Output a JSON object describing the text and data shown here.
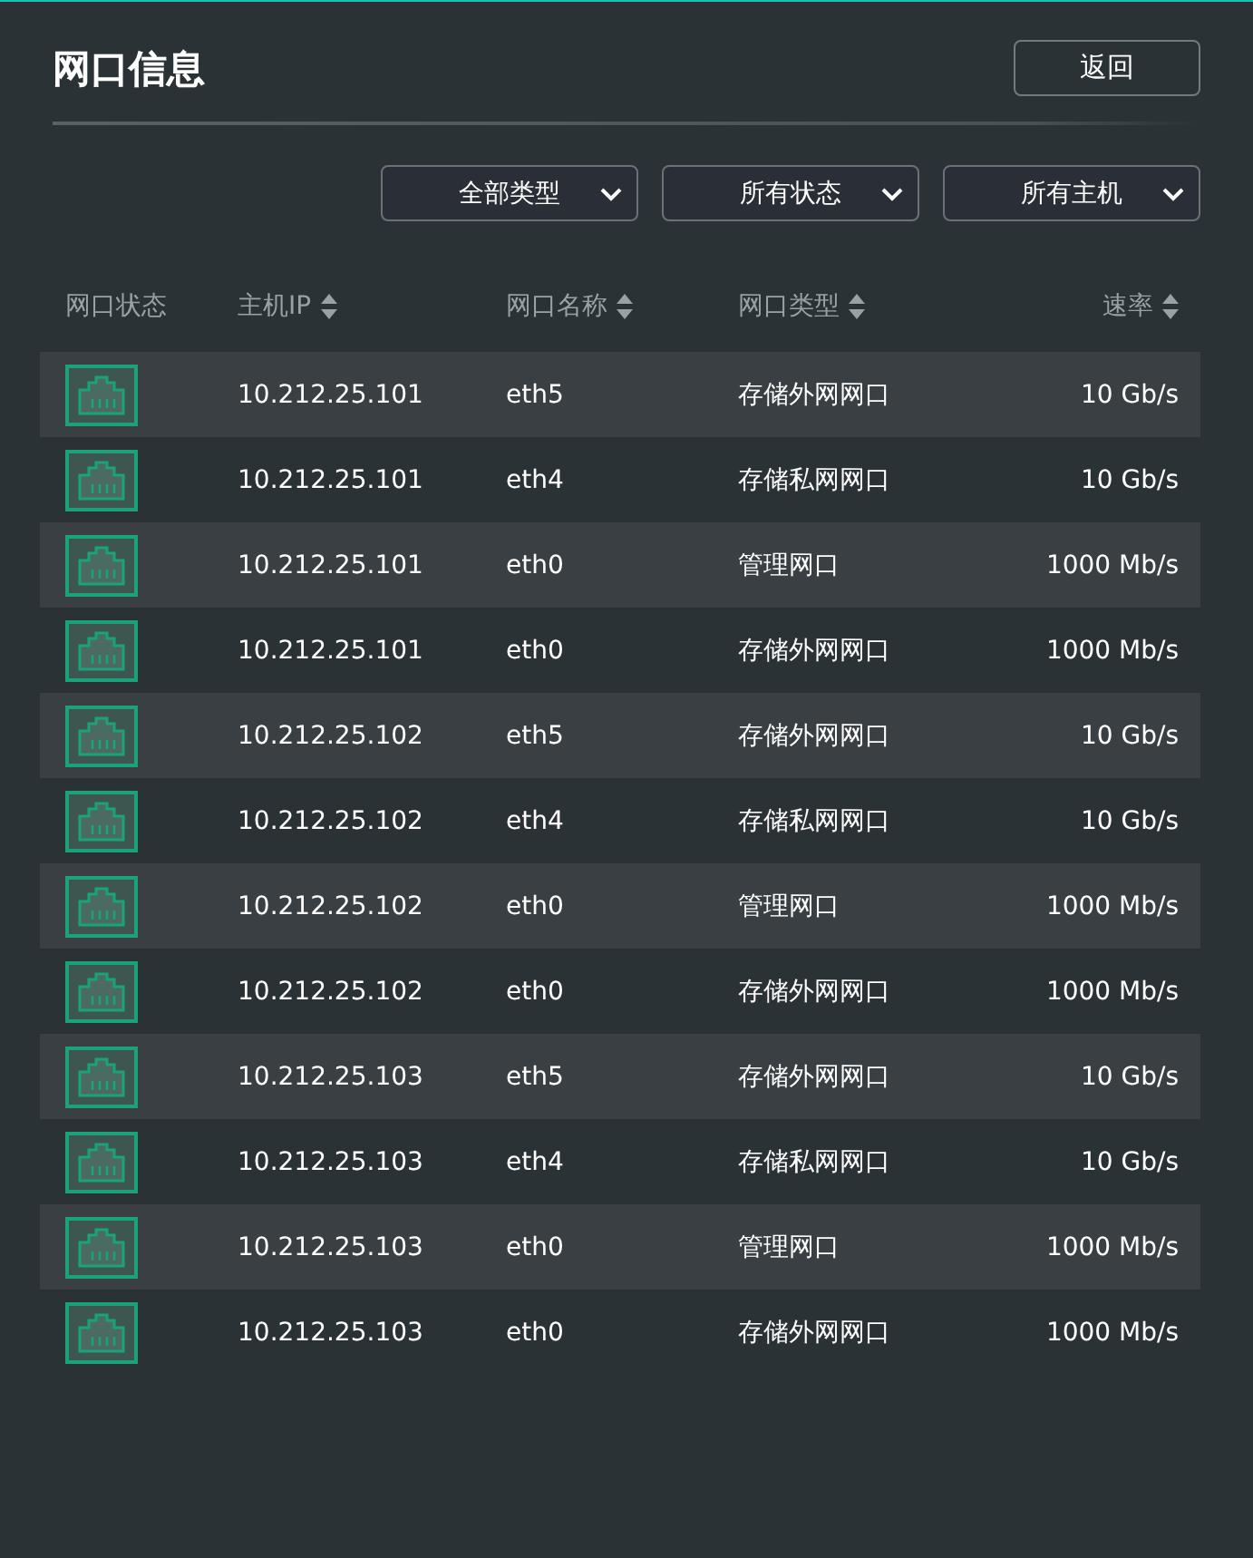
{
  "title": "网口信息",
  "back_button": "返回",
  "filters": [
    {
      "label": "全部类型"
    },
    {
      "label": "所有状态"
    },
    {
      "label": "所有主机"
    }
  ],
  "columns": [
    {
      "label": "网口状态",
      "sortable": false
    },
    {
      "label": "主机IP",
      "sortable": true
    },
    {
      "label": "网口名称",
      "sortable": true
    },
    {
      "label": "网口类型",
      "sortable": true
    },
    {
      "label": "速率",
      "sortable": true
    }
  ],
  "rows": [
    {
      "connected": true,
      "ip": "10.212.25.101",
      "name": "eth5",
      "type": "存储外网网口",
      "speed": "10 Gb/s"
    },
    {
      "connected": true,
      "ip": "10.212.25.101",
      "name": "eth4",
      "type": "存储私网网口",
      "speed": "10 Gb/s"
    },
    {
      "connected": true,
      "ip": "10.212.25.101",
      "name": "eth0",
      "type": "管理网口",
      "speed": "1000 Mb/s"
    },
    {
      "connected": true,
      "ip": "10.212.25.101",
      "name": "eth0",
      "type": "存储外网网口",
      "speed": "1000 Mb/s"
    },
    {
      "connected": true,
      "ip": "10.212.25.102",
      "name": "eth5",
      "type": "存储外网网口",
      "speed": "10 Gb/s"
    },
    {
      "connected": true,
      "ip": "10.212.25.102",
      "name": "eth4",
      "type": "存储私网网口",
      "speed": "10 Gb/s"
    },
    {
      "connected": true,
      "ip": "10.212.25.102",
      "name": "eth0",
      "type": "管理网口",
      "speed": "1000 Mb/s"
    },
    {
      "connected": true,
      "ip": "10.212.25.102",
      "name": "eth0",
      "type": "存储外网网口",
      "speed": "1000 Mb/s"
    },
    {
      "connected": true,
      "ip": "10.212.25.103",
      "name": "eth5",
      "type": "存储外网网口",
      "speed": "10 Gb/s"
    },
    {
      "connected": true,
      "ip": "10.212.25.103",
      "name": "eth4",
      "type": "存储私网网口",
      "speed": "10 Gb/s"
    },
    {
      "connected": true,
      "ip": "10.212.25.103",
      "name": "eth0",
      "type": "管理网口",
      "speed": "1000 Mb/s"
    },
    {
      "connected": true,
      "ip": "10.212.25.103",
      "name": "eth0",
      "type": "存储外网网口",
      "speed": "1000 Mb/s"
    }
  ]
}
